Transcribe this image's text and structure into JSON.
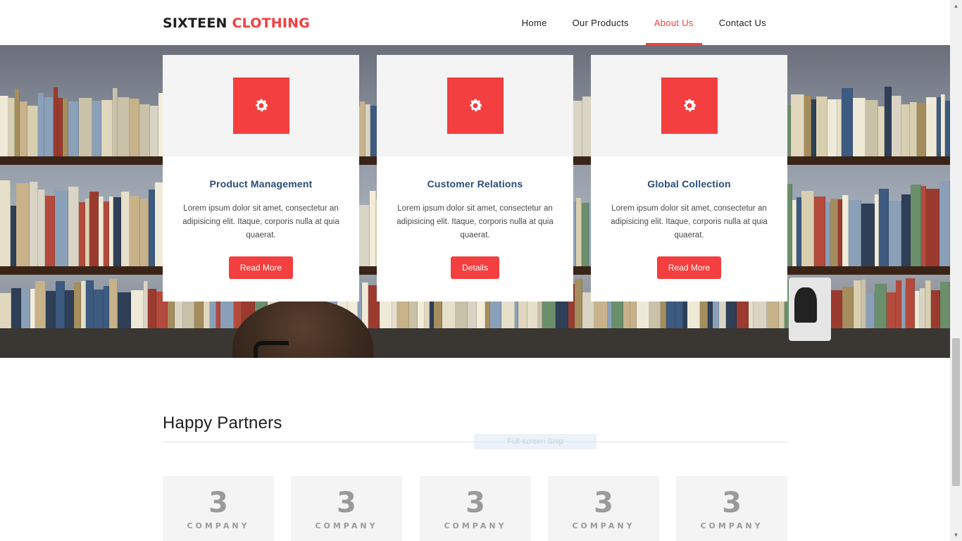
{
  "header": {
    "logo_main": "SIXTEEN",
    "logo_accent": "CLOTHING",
    "nav": [
      {
        "label": "Home",
        "active": false
      },
      {
        "label": "Our Products",
        "active": false
      },
      {
        "label": "About Us",
        "active": true
      },
      {
        "label": "Contact Us",
        "active": false
      }
    ]
  },
  "colors": {
    "accent": "#f33f3f",
    "card_title": "#2a4d75",
    "card_top_bg": "#f4f4f4"
  },
  "cards": [
    {
      "icon": "gear-icon",
      "title": "Product Management",
      "text": "Lorem ipsum dolor sit amet, consectetur an adipisicing elit. Itaque, corporis nulla at quia quaerat.",
      "button": "Read More"
    },
    {
      "icon": "gear-icon",
      "title": "Customer Relations",
      "text": "Lorem ipsum dolor sit amet, consectetur an adipisicing elit. Itaque, corporis nulla at quia quaerat.",
      "button": "Details"
    },
    {
      "icon": "gear-icon",
      "title": "Global Collection",
      "text": "Lorem ipsum dolor sit amet, consectetur an adipisicing elit. Itaque, corporis nulla at quia quaerat.",
      "button": "Read More"
    }
  ],
  "partners": {
    "title": "Happy Partners",
    "logos": [
      {
        "glyph": "3",
        "word": "COMPANY"
      },
      {
        "glyph": "3",
        "word": "COMPANY"
      },
      {
        "glyph": "3",
        "word": "COMPANY"
      },
      {
        "glyph": "3",
        "word": "COMPANY"
      },
      {
        "glyph": "3",
        "word": "COMPANY"
      }
    ]
  },
  "overlay": {
    "snip_label": "Full-screen Snip"
  }
}
